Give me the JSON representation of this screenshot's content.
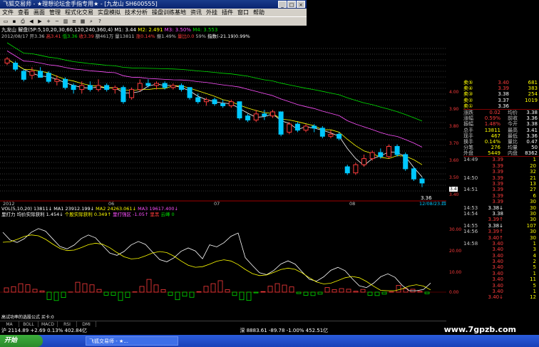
{
  "window": {
    "title": "飞狐交易师 - ★理想论坛金手指专用★ - [九龙山 SH600555]",
    "controls": [
      "_",
      "□",
      "×"
    ]
  },
  "menu": [
    "文件",
    "查看",
    "画面",
    "管理",
    "程式化交易",
    "实盘模拟",
    "技术分析",
    "操盘训练基地",
    "资讯",
    "外挂",
    "插件",
    "窗口",
    "帮助"
  ],
  "toolbar_icons": [
    "open-icon",
    "save-icon",
    "print-icon",
    "back-icon",
    "forward-icon",
    "zoom-in-icon",
    "zoom-out-icon",
    "chart-icon",
    "list-icon",
    "grid-icon",
    "search-icon",
    "help-icon"
  ],
  "price_bar": {
    "name": "九龙山",
    "ma_text": "解盘(5P:5,10,20,30,60,120,240,360,4)",
    "m1": "M1: 3.44",
    "m2": "M2: 2.491",
    "m3": "M3: 3.50%",
    "m4": "M4: 3.553"
  },
  "info_bar": {
    "date": "2012/08/17",
    "open": "开3.36",
    "high": "高3.41",
    "low": "低3.36",
    "close": "收3.39",
    "amount": "额461万",
    "vol": "量13811",
    "change": "涨0.14%",
    "amp": "振1.49%",
    "extra": "量比0.0",
    "pct": "59%",
    "index": "指数(-21.19)0.99%"
  },
  "chart_data": {
    "type": "candlestick",
    "price_axis": [
      "4.00",
      "3.90",
      "3.80",
      "3.70",
      "3.60",
      "3.50",
      "3.40"
    ],
    "last_price_label": "3.4",
    "low_label": "3.36",
    "date_labels": [
      "2012",
      "06",
      "07",
      "08"
    ],
    "current_date": "12/08/23,四",
    "lower_axis": [
      "30.00",
      "20.00",
      "10.00",
      "0.00"
    ],
    "candles": [
      {
        "o": 3.97,
        "c": 3.99,
        "h": 4.0,
        "l": 3.96
      },
      {
        "o": 3.97,
        "c": 3.94,
        "h": 3.98,
        "l": 3.93
      },
      {
        "o": 3.93,
        "c": 3.89,
        "h": 3.94,
        "l": 3.88
      },
      {
        "o": 3.91,
        "c": 3.93,
        "h": 3.95,
        "l": 3.89
      },
      {
        "o": 3.93,
        "c": 3.9,
        "h": 3.95,
        "l": 3.9
      },
      {
        "o": 3.92,
        "c": 3.88,
        "h": 3.93,
        "l": 3.87
      },
      {
        "o": 3.88,
        "c": 3.89,
        "h": 3.91,
        "l": 3.86
      },
      {
        "o": 3.89,
        "c": 3.85,
        "h": 3.9,
        "l": 3.84
      },
      {
        "o": 3.86,
        "c": 3.84,
        "h": 3.87,
        "l": 3.82
      },
      {
        "o": 3.84,
        "c": 3.86,
        "h": 3.88,
        "l": 3.82
      },
      {
        "o": 3.86,
        "c": 3.84,
        "h": 3.88,
        "l": 3.83
      },
      {
        "o": 3.84,
        "c": 3.86,
        "h": 3.89,
        "l": 3.83
      },
      {
        "o": 3.86,
        "c": 3.84,
        "h": 3.87,
        "l": 3.83
      },
      {
        "o": 3.84,
        "c": 3.85,
        "h": 3.86,
        "l": 3.82
      },
      {
        "o": 3.85,
        "c": 3.78,
        "h": 3.86,
        "l": 3.77
      },
      {
        "o": 3.8,
        "c": 3.84,
        "h": 3.85,
        "l": 3.79
      },
      {
        "o": 3.84,
        "c": 3.87,
        "h": 3.89,
        "l": 3.83
      },
      {
        "o": 3.87,
        "c": 3.86,
        "h": 3.89,
        "l": 3.85
      },
      {
        "o": 3.86,
        "c": 3.87,
        "h": 3.88,
        "l": 3.84
      },
      {
        "o": 3.87,
        "c": 3.85,
        "h": 3.88,
        "l": 3.84
      },
      {
        "o": 3.85,
        "c": 3.86,
        "h": 3.87,
        "l": 3.84
      },
      {
        "o": 3.86,
        "c": 3.84,
        "h": 3.87,
        "l": 3.83
      },
      {
        "o": 3.85,
        "c": 3.8,
        "h": 3.85,
        "l": 3.79
      },
      {
        "o": 3.8,
        "c": 3.78,
        "h": 3.82,
        "l": 3.77
      },
      {
        "o": 3.78,
        "c": 3.79,
        "h": 3.8,
        "l": 3.76
      },
      {
        "o": 3.79,
        "c": 3.77,
        "h": 3.8,
        "l": 3.76
      },
      {
        "o": 3.77,
        "c": 3.76,
        "h": 3.79,
        "l": 3.75
      },
      {
        "o": 3.76,
        "c": 3.78,
        "h": 3.79,
        "l": 3.75
      },
      {
        "o": 3.78,
        "c": 3.7,
        "h": 3.78,
        "l": 3.69
      },
      {
        "o": 3.71,
        "c": 3.69,
        "h": 3.72,
        "l": 3.68
      },
      {
        "o": 3.69,
        "c": 3.72,
        "h": 3.74,
        "l": 3.68
      },
      {
        "o": 3.72,
        "c": 3.71,
        "h": 3.74,
        "l": 3.69
      },
      {
        "o": 3.71,
        "c": 3.73,
        "h": 3.74,
        "l": 3.7
      },
      {
        "o": 3.73,
        "c": 3.62,
        "h": 3.73,
        "l": 3.61
      },
      {
        "o": 3.63,
        "c": 3.67,
        "h": 3.68,
        "l": 3.62
      },
      {
        "o": 3.67,
        "c": 3.64,
        "h": 3.68,
        "l": 3.63
      },
      {
        "o": 3.64,
        "c": 3.66,
        "h": 3.67,
        "l": 3.63
      },
      {
        "o": 3.66,
        "c": 3.65,
        "h": 3.67,
        "l": 3.63
      },
      {
        "o": 3.65,
        "c": 3.61,
        "h": 3.66,
        "l": 3.6
      },
      {
        "o": 3.61,
        "c": 3.62,
        "h": 3.64,
        "l": 3.6
      },
      {
        "o": 3.62,
        "c": 3.6,
        "h": 3.63,
        "l": 3.59
      },
      {
        "o": 3.46,
        "c": 3.43,
        "h": 3.47,
        "l": 3.42
      },
      {
        "o": 3.43,
        "c": 3.47,
        "h": 3.48,
        "l": 3.42
      },
      {
        "o": 3.47,
        "c": 3.5,
        "h": 3.52,
        "l": 3.46
      },
      {
        "o": 3.5,
        "c": 3.53,
        "h": 3.54,
        "l": 3.49
      },
      {
        "o": 3.53,
        "c": 3.51,
        "h": 3.55,
        "l": 3.5
      },
      {
        "o": 3.51,
        "c": 3.56,
        "h": 3.57,
        "l": 3.5
      },
      {
        "o": 3.56,
        "c": 3.52,
        "h": 3.57,
        "l": 3.51
      },
      {
        "o": 3.52,
        "c": 3.45,
        "h": 3.53,
        "l": 3.44
      },
      {
        "o": 3.45,
        "c": 3.4,
        "h": 3.46,
        "l": 3.39
      },
      {
        "o": 3.4,
        "c": 3.38,
        "h": 3.41,
        "l": 3.36
      }
    ]
  },
  "vol_bar": {
    "label": "VOL(5,10,20)",
    "v": "13811↓",
    "ma1": "MA1 23912.199↓",
    "ma2": "MA2 24263.061↓",
    "ma3": "MA3 19617.400↓"
  },
  "indicator_label": {
    "name": "里打力",
    "t1": "均价实际获利 1.454↓",
    "t2": "个股实际获利 0.349↑",
    "t3": "里打强区 -1.05↑",
    "t4": "里黑",
    "t5": "云峰 0"
  },
  "formula_text": "高试功率的选股公式  买卡:0",
  "ind_tabs": [
    "MA",
    "BOLL",
    "MACD",
    "RSI",
    "DMI"
  ],
  "quotes": {
    "sells": [
      {
        "label": "卖⑤",
        "price": "3.40",
        "vol": "681",
        "pc": "r"
      },
      {
        "label": "卖④",
        "price": "3.39",
        "vol": "383",
        "pc": "r"
      },
      {
        "label": "卖③",
        "price": "3.38",
        "vol": "254",
        "pc": "w"
      },
      {
        "label": "卖②",
        "price": "3.37",
        "vol": "1019",
        "pc": "w"
      },
      {
        "label": "卖①",
        "price": "3.36",
        "vol": "",
        "pc": "w"
      }
    ],
    "stats": [
      {
        "k1": "涨跌",
        "v1": "0.02",
        "k2": "均价",
        "v2": "3.38"
      },
      {
        "k1": "涨幅",
        "v1": "0.59%",
        "k2": "前收",
        "v2": "3.36"
      },
      {
        "k1": "振幅",
        "v1": "1.48%",
        "k2": "今开",
        "v2": "3.38"
      },
      {
        "k1": "总手",
        "v1": "13811",
        "k2": "最高",
        "v2": "3.41"
      },
      {
        "k1": "现手",
        "v1": "467",
        "k2": "最低",
        "v2": "3.36"
      },
      {
        "k1": "换手",
        "v1": "0.14%",
        "k2": "量比",
        "v2": "0.47"
      },
      {
        "k1": "分笔",
        "v1": "276",
        "k2": "均量",
        "v2": "50"
      },
      {
        "k1": "外盘",
        "v1": "5449",
        "k2": "内盘",
        "v2": "8362"
      }
    ],
    "buy_side": [
      {
        "label": "买①",
        "price": "",
        "vol": ""
      }
    ]
  },
  "ticks": [
    {
      "t": "14:49",
      "p": "3.39",
      "v": "1"
    },
    {
      "t": "",
      "p": "3.39",
      "v": "20"
    },
    {
      "t": "",
      "p": "3.39",
      "v": "32"
    },
    {
      "t": "14:50",
      "p": "3.39",
      "v": "21"
    },
    {
      "t": "",
      "p": "3.39",
      "v": "13"
    },
    {
      "t": "14:51",
      "p": "3.39",
      "v": "27"
    },
    {
      "t": "",
      "p": "3.39",
      "v": "6"
    },
    {
      "t": "",
      "p": "3.39",
      "v": "30"
    },
    {
      "t": "14:53",
      "p": "3.38↓",
      "v": "30"
    },
    {
      "t": "14:54",
      "p": "3.38",
      "v": "30"
    },
    {
      "t": "",
      "p": "3.39↑",
      "v": "30"
    },
    {
      "t": "14:55",
      "p": "3.38↓",
      "v": "107"
    },
    {
      "t": "14:56",
      "p": "3.39↑",
      "v": "30"
    },
    {
      "t": "",
      "p": "3.40↑",
      "v": "30"
    },
    {
      "t": "14:58",
      "p": "3.40",
      "v": "1"
    },
    {
      "t": "",
      "p": "3.40",
      "v": "3"
    },
    {
      "t": "",
      "p": "3.40",
      "v": "4"
    },
    {
      "t": "",
      "p": "3.40",
      "v": "2"
    },
    {
      "t": "",
      "p": "3.40",
      "v": "5"
    },
    {
      "t": "",
      "p": "3.40",
      "v": "1"
    },
    {
      "t": "",
      "p": "3.40",
      "v": "11"
    },
    {
      "t": "",
      "p": "3.40",
      "v": "5"
    },
    {
      "t": "",
      "p": "3.40",
      "v": "1"
    },
    {
      "t": "",
      "p": "3.40↓",
      "v": "12"
    }
  ],
  "status_bar": {
    "sh": "沪 2114.89  +2.69  0.13%  402.84亿",
    "sz": "深 8883.61  -89.78  -1.00%  452.51亿"
  },
  "taskbar": {
    "start": "开始",
    "item": "飞狐交易师 - ★..."
  },
  "watermark": "www.7gpzb.com",
  "colors": {
    "up": "#ff3c3c",
    "down": "#00c8ff",
    "ma5": "#ffffff",
    "ma10": "#ffff00",
    "ma20": "#ff50ff",
    "ma60": "#00e000"
  }
}
